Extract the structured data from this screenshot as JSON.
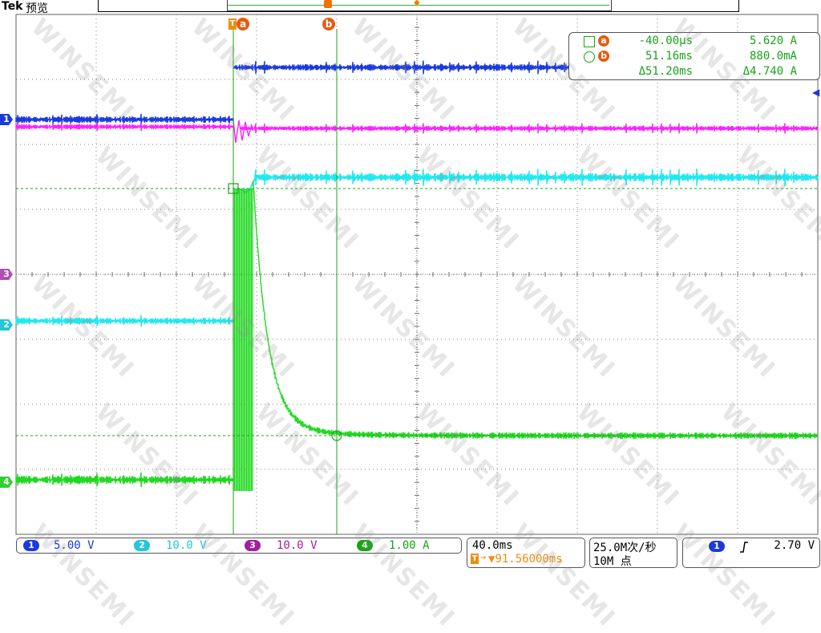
{
  "header": {
    "brand": "Tek",
    "mode": "预览"
  },
  "cursors": {
    "a_label": "a",
    "b_label": "b",
    "trigger_tag": "T"
  },
  "channel_markers": [
    {
      "num": "1",
      "color": "#1a3adc"
    },
    {
      "num": "3",
      "color": "#b050b0"
    },
    {
      "num": "2",
      "color": "#20c8d8"
    },
    {
      "num": "4",
      "color": "#30d030"
    }
  ],
  "readout": {
    "row1": {
      "time": "-40.00µs",
      "value": "5.620 A"
    },
    "row2": {
      "time": "51.16ms",
      "value": "880.0mA"
    },
    "row3": {
      "time": "Δ51.20ms",
      "value": "Δ4.740 A"
    }
  },
  "channels": [
    {
      "num": "1",
      "scale": "5.00 V",
      "color": "#1a3adc"
    },
    {
      "num": "2",
      "scale": "10.0 V",
      "color": "#20c8d8"
    },
    {
      "num": "3",
      "scale": "10.0 V",
      "color": "#a020a0"
    },
    {
      "num": "4",
      "scale": "1.00 A",
      "color": "#18a418"
    }
  ],
  "timebase": {
    "scale": "40.0ms",
    "trigger_pos": "▼91.56000ms"
  },
  "acquisition": {
    "rate": "25.0M次/秒",
    "length": "10M 点"
  },
  "trigger": {
    "source": "1",
    "slope": "rising",
    "level": "2.70 V"
  },
  "watermark": "WINSEMI",
  "colors": {
    "ch1": "#1a3adc",
    "ch2": "#20e8f0",
    "ch3": "#ff20ff",
    "ch4": "#20d820",
    "cursor": "#18a418",
    "grid": "#808080"
  }
}
